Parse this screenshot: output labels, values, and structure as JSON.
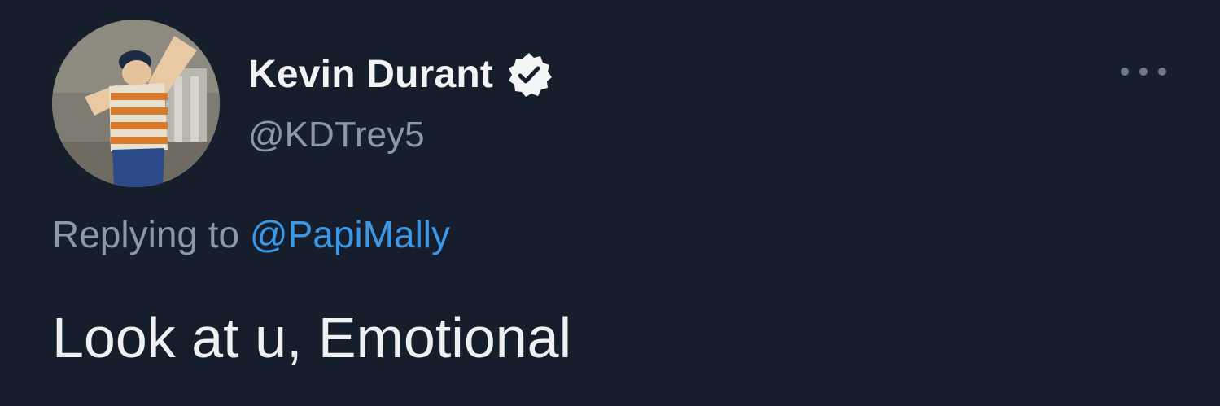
{
  "tweet": {
    "author": {
      "display_name": "Kevin Durant",
      "handle": "@KDTrey5",
      "verified": true,
      "avatar_icon": "avatar-photo"
    },
    "reply": {
      "prefix": "Replying to",
      "mention": "@PapiMally"
    },
    "text": "Look at u, Emotional",
    "more_icon": "more-options-icon"
  },
  "colors": {
    "background": "#161e2b",
    "name": "#f2f3f5",
    "secondary": "#8b98a5",
    "link": "#3a98e8",
    "text": "#eef0f2"
  }
}
